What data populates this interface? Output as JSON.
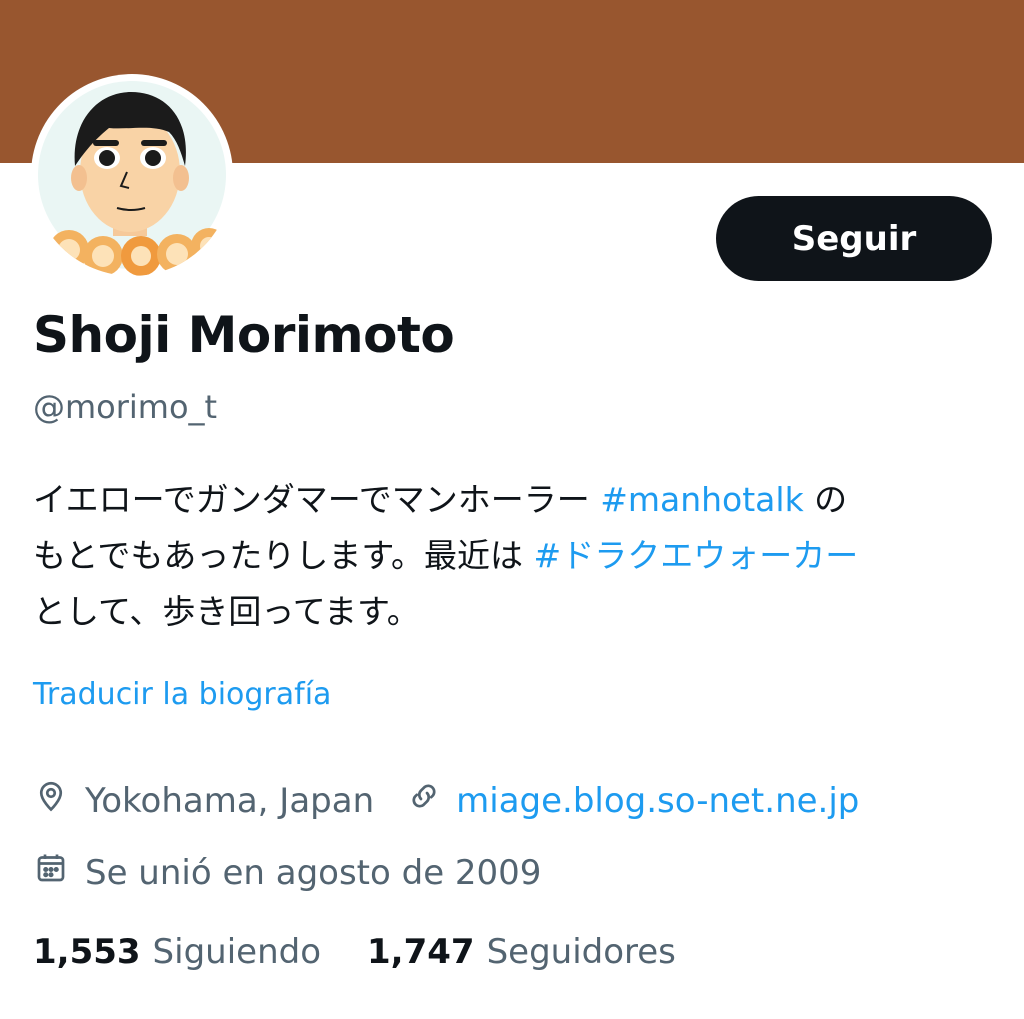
{
  "profile": {
    "name": "Shoji Morimoto",
    "handle": "@morimo_t",
    "follow_label": "Seguir",
    "bio": {
      "line1_text": "イエローでガンダマーでマンホーラー ",
      "line1_tag": "#manhotalk",
      "line1_end": " の",
      "line2_text": "もとでもあったりします。最近は ",
      "line2_tag": "#ドラクエウォーカー",
      "line3_text": "として、歩き回ってます。"
    },
    "translate_label": "Traducir la biografía",
    "location": "Yokohama, Japan",
    "website": "miage.blog.so-net.ne.jp",
    "joined": "Se unió en agosto de 2009",
    "following_count": "1,553",
    "following_label": "Siguiendo",
    "followers_count": "1,747",
    "followers_label": "Seguidores"
  },
  "icons": {
    "location": "location-pin-icon",
    "website": "link-icon",
    "joined": "calendar-icon"
  },
  "colors": {
    "banner": "#98562f",
    "accent": "#1d9bf0",
    "text": "#0f1419",
    "secondary": "#536471",
    "button": "#0f1419"
  }
}
